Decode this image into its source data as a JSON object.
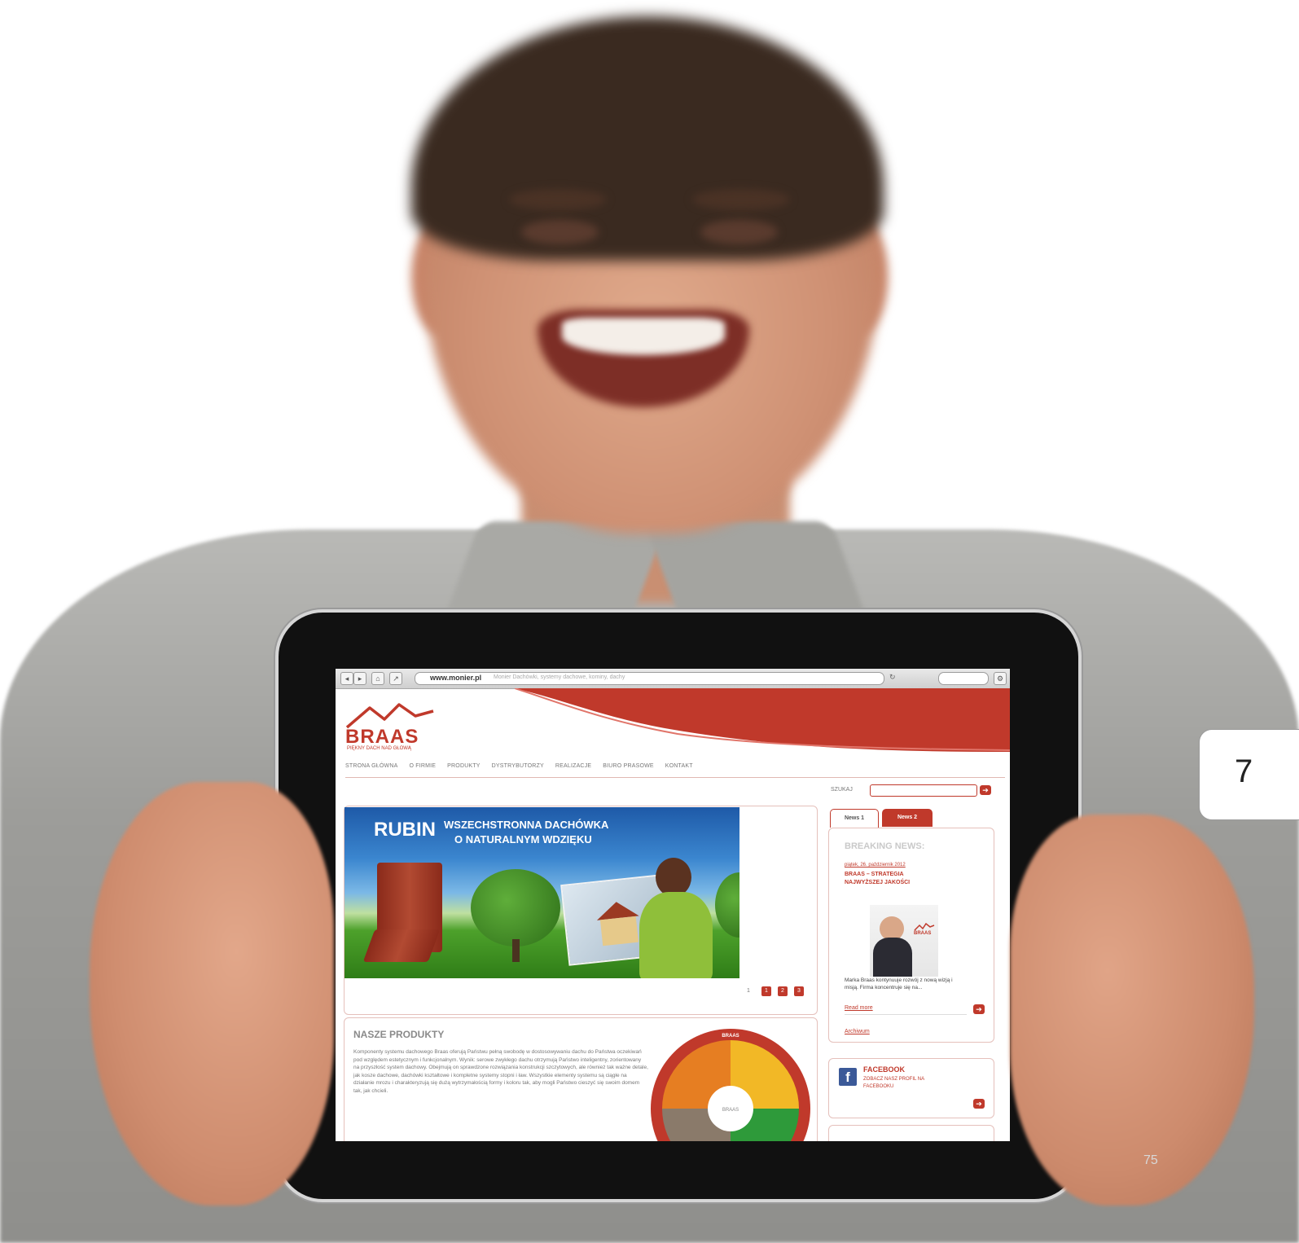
{
  "browser": {
    "url": "www.monier.pl",
    "url_description": "Monier Dachówki, systemy dachowe, kominy, dachy"
  },
  "site": {
    "logo": "BRAAS",
    "tagline": "PIĘKNY DACH NAD GŁOWĄ",
    "nav": [
      "STRONA GŁÓWNA",
      "O FIRMIE",
      "PRODUKTY",
      "DYSTRYBUTORZY",
      "REALIZACJE",
      "BIURO PRASOWE",
      "KONTAKT"
    ],
    "search_label": "SZUKAJ"
  },
  "banner": {
    "brand": "RUBIN",
    "line1": "WSZECHSTRONNA DACHÓWKA",
    "line2": "O NATURALNYM WDZIĘKU"
  },
  "slider": {
    "current": "1",
    "pages": [
      "1",
      "2",
      "3"
    ]
  },
  "products": {
    "title": "NASZE PRODUKTY",
    "body": "Komponenty systemu dachowego Braas oferują Państwu pełną swobodę w dostosowywaniu dachu do Państwa oczekiwań pod względem estetycznym i funkcjonalnym. Wynik: serowe zwykłego dachu otrzymują Państwo inteligentny, zorientowany na przyszłość system dachowy. Obejmują on sprawdzone rozwiązania konstrukcji szczytowych, ale również tak ważne detale, jak kosze dachowe, dachówki kształtowe i kompletne systemy stopni i ław. Wszystkie elementy systemu są ciągłe na działanie mrozu i charakteryzują się dużą wytrzymałością formy i koloru tak, aby mogli Państwo cieszyć się swoim domem tak, jak chcieli.",
    "diagram_brand": "BRAAS",
    "diagram_center": "BRAAS"
  },
  "news": {
    "tab1": "News 1",
    "tab2": "News 2",
    "title": "BREAKING NEWS:",
    "date": "piątek, 26. październik 2012",
    "headline1": "BRAAS – STRATEGIA",
    "headline2": "NAJWYŻSZEJ JAKOŚCI",
    "photo_logo": "BRAAS",
    "excerpt": "Marka Braas kontynuuje rozwój z nową wizją i misją. Firma koncentruje się na...",
    "read_more": "Read more",
    "archive": "Archiwum"
  },
  "facebook": {
    "icon": "f",
    "title": "FACEBOOK",
    "link1": "ZOBACZ NASZ PROFIL NA",
    "link2": "FACEBOOKU"
  },
  "page": {
    "chapter": "7",
    "number": "75"
  },
  "colors": {
    "brand_red": "#c0392b",
    "facebook_blue": "#3b5998",
    "tablet_bezel": "#111111"
  }
}
